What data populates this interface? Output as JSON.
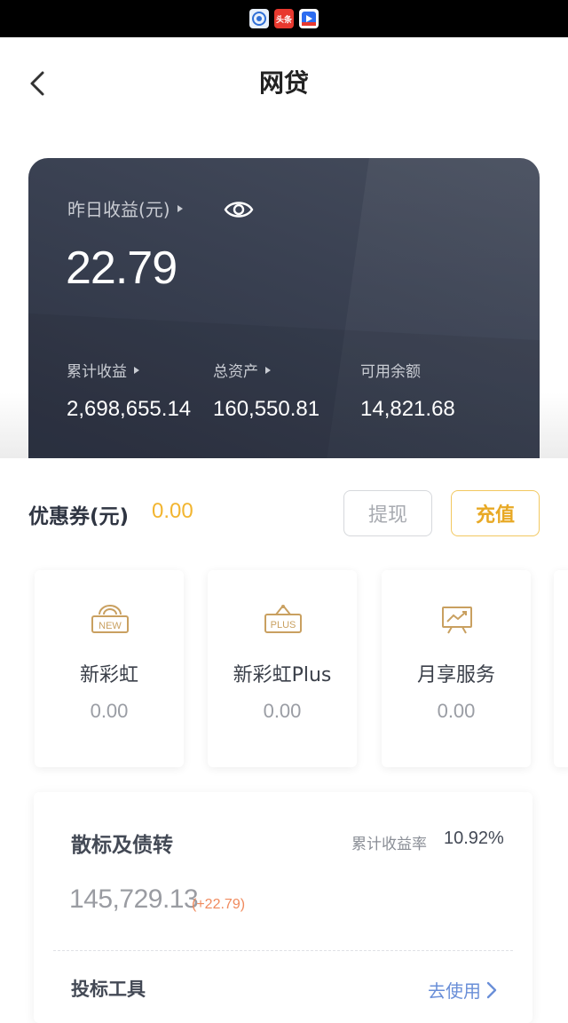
{
  "status_bar": {
    "icons": [
      {
        "name": "app-icon-1",
        "text": "",
        "color": "#e8f0fb"
      },
      {
        "name": "toutiao-icon",
        "text": "头条",
        "color": "#e8392f"
      },
      {
        "name": "video-app-icon",
        "text": "",
        "color": "#ffffff"
      }
    ]
  },
  "header": {
    "back_icon": "chevron-left-icon",
    "title": "网贷"
  },
  "earnings_card": {
    "yesterday_label": "昨日收益(元)",
    "yesterday_value": "22.79",
    "visibility_icon": "eye-icon",
    "stats": [
      {
        "label": "累计收益",
        "value": "2,698,655.14",
        "has_arrow": true
      },
      {
        "label": "总资产",
        "value": "160,550.81",
        "has_arrow": true
      },
      {
        "label": "可用余额",
        "value": "14,821.68",
        "has_arrow": false
      }
    ],
    "colors": {
      "bg_start": "#454c5c",
      "bg_end": "#2c3242"
    }
  },
  "coupon": {
    "label": "优惠券(元)",
    "value": "0.00",
    "withdraw_label": "提现",
    "recharge_label": "充值",
    "accent": "#e8a925"
  },
  "products": [
    {
      "icon": "new-badge-icon",
      "badge": "NEW",
      "name": "新彩虹",
      "value": "0.00"
    },
    {
      "icon": "plus-sign-icon",
      "badge": "PLUS",
      "name": "新彩虹Plus",
      "value": "0.00"
    },
    {
      "icon": "chart-trend-icon",
      "badge": "",
      "name": "月享服务",
      "value": "0.00"
    }
  ],
  "loan_section": {
    "title": "散标及债转",
    "rate_label": "累计收益率",
    "rate_value": "10.92%",
    "amount": "145,729.13",
    "delta": "(+22.79)",
    "tool_label": "投标工具",
    "tool_link": "去使用"
  }
}
